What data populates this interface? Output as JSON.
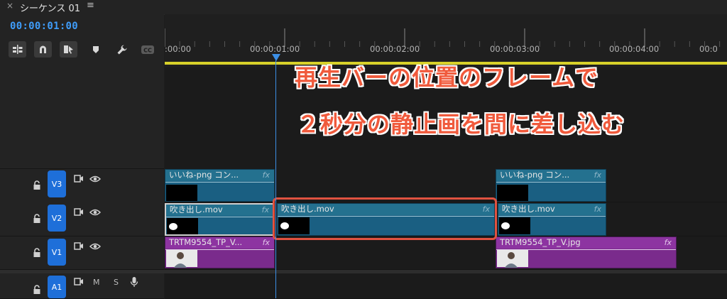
{
  "panel": {
    "close_glyph": "×",
    "title": "シーケンス 01",
    "menu_glyph": "≡"
  },
  "timecode": "00:00:01:00",
  "tools": [
    {
      "name": "insert-ripple-icon"
    },
    {
      "name": "snap-magnet-icon"
    },
    {
      "name": "linked-selection-icon"
    },
    {
      "name": "add-marker-icon"
    },
    {
      "name": "wrench-settings-icon"
    },
    {
      "name": "captions-cc-icon"
    }
  ],
  "ruler": {
    "labels": [
      ":00:00",
      "00:00:01:00",
      "00:00:02:00",
      "00:00:03:00",
      "00:00:04:00",
      "00:0"
    ]
  },
  "tracks": [
    {
      "id": "V3",
      "label": "V3"
    },
    {
      "id": "V2",
      "label": "V2"
    },
    {
      "id": "V1",
      "label": "V1"
    },
    {
      "id": "A1",
      "label": "A1",
      "m": "M",
      "s": "S"
    }
  ],
  "clips": {
    "v3_a": {
      "name": "いいね-png コン...",
      "fx": "fx"
    },
    "v3_b": {
      "name": "いいね-png コン...",
      "fx": "fx"
    },
    "v2_a": {
      "name": "吹き出し.mov",
      "fx": "fx"
    },
    "v2_b": {
      "name": "吹き出し.mov",
      "fx": "fx"
    },
    "v2_c": {
      "name": "吹き出し.mov",
      "fx": "fx"
    },
    "v1_a": {
      "name": "TRTM9554_TP_V...",
      "fx": "fx"
    },
    "v1_b": {
      "name": "TRTM9554_TP_V.jpg",
      "fx": "fx"
    }
  },
  "caption": {
    "line1": "再生バーの位置のフレームで",
    "line2": "２秒分の静止画を間に差し込む"
  },
  "colors": {
    "timecode": "#3f9dfa",
    "track_badge": "#1e6fd9",
    "clip_blue": "#1a5f82",
    "clip_purple": "#7a2b8c",
    "caption": "#f05a3c",
    "highlight": "#e05240"
  }
}
